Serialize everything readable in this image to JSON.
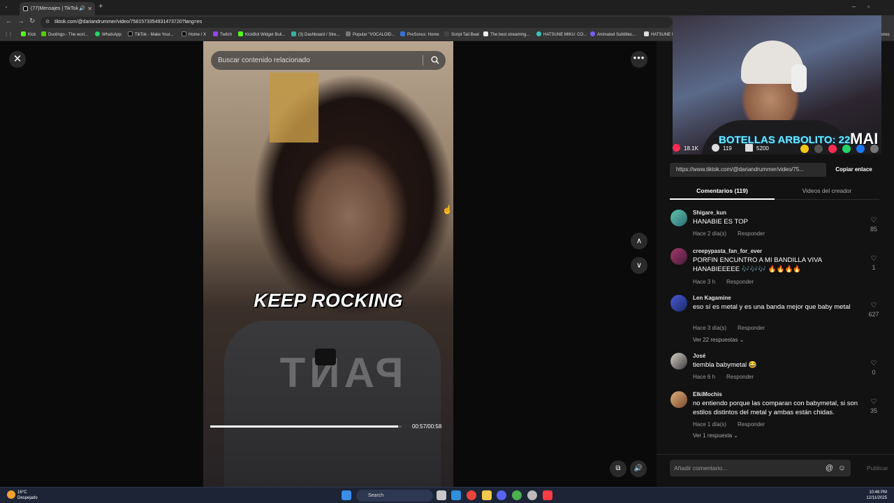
{
  "browser": {
    "tab_title": "(77)Mensajes | TikTok",
    "url": "tiktok.com/@dariandrummer/video/7581573354931473720?lang=es",
    "bookmarks": [
      "Kick",
      "Duolingo - The worl...",
      "WhatsApp",
      "TikTok - Make Your...",
      "Home / X",
      "Twitch",
      "KickBot Widget Buil...",
      "(3) Dashboard / Stre...",
      "Popular \"VOCALOID...",
      "PreSonus: Home",
      "Script Tail Beat",
      "The best streaming...",
      "HATSUNE MIKU: CO...",
      "Animated Subtitles...",
      "HATSUNE M"
    ],
    "bookmarks_overflow": "ores"
  },
  "player": {
    "search_placeholder": "Buscar contenido relacionado",
    "caption": "KEEP ROCKING",
    "time": "00:57/00:58",
    "progress": 0.983
  },
  "overlay": {
    "counter": "BOTELLAS ARBOLITO: 22",
    "logo": "MAI"
  },
  "actions": {
    "likes": "18.1K",
    "comments": "119",
    "saves": "5200"
  },
  "share": {
    "link": "https://www.tiktok.com/@dariandrummer/video/75...",
    "copy_label": "Copiar enlace"
  },
  "tabs": {
    "comments": "Comentarios (119)",
    "creator": "Videos del creador"
  },
  "comments": [
    {
      "user": "Shigare_kun",
      "text": "HANABIE ES TOP",
      "time": "Hace 2 día(s)",
      "reply": "Responder",
      "likes": "85",
      "replies": ""
    },
    {
      "user": "creepypasta_fan_for_ever",
      "text": "PORFIN ENCUNTRO A MI BANDILLA VIVA HANABIEEEEE 🎶🎶🎶 🔥🔥🔥🔥",
      "time": "Hace 3 h",
      "reply": "Responder",
      "likes": "1",
      "replies": ""
    },
    {
      "user": "Len Kagamine",
      "text": "eso sí es metal y es una banda mejor que baby metal",
      "time": "Hace 3 día(s)",
      "reply": "Responder",
      "likes": "627",
      "replies": "Ver 22 respuestas"
    },
    {
      "user": "José",
      "text": "tiembla babymetal 😂",
      "time": "Hace 6 h",
      "reply": "Responder",
      "likes": "0",
      "replies": ""
    },
    {
      "user": "ElkiMochis",
      "text": "no entiendo porque las comparan con babymetal, si son estilos distintos del metal y ambas están chidas.",
      "time": "Hace 1 día(s)",
      "reply": "Responder",
      "likes": "35",
      "replies": "Ver 1 respuesta"
    }
  ],
  "composer": {
    "placeholder": "Añadir comentario...",
    "publish": "Publicar"
  },
  "taskbar": {
    "temp": "16°C",
    "weather": "Despejado",
    "search": "Search",
    "time": "10:46 PM",
    "date": "12/11/2025"
  },
  "colors": {
    "accent_red": "#fe2c55",
    "overlay_cyan": "#6fe7ff"
  }
}
